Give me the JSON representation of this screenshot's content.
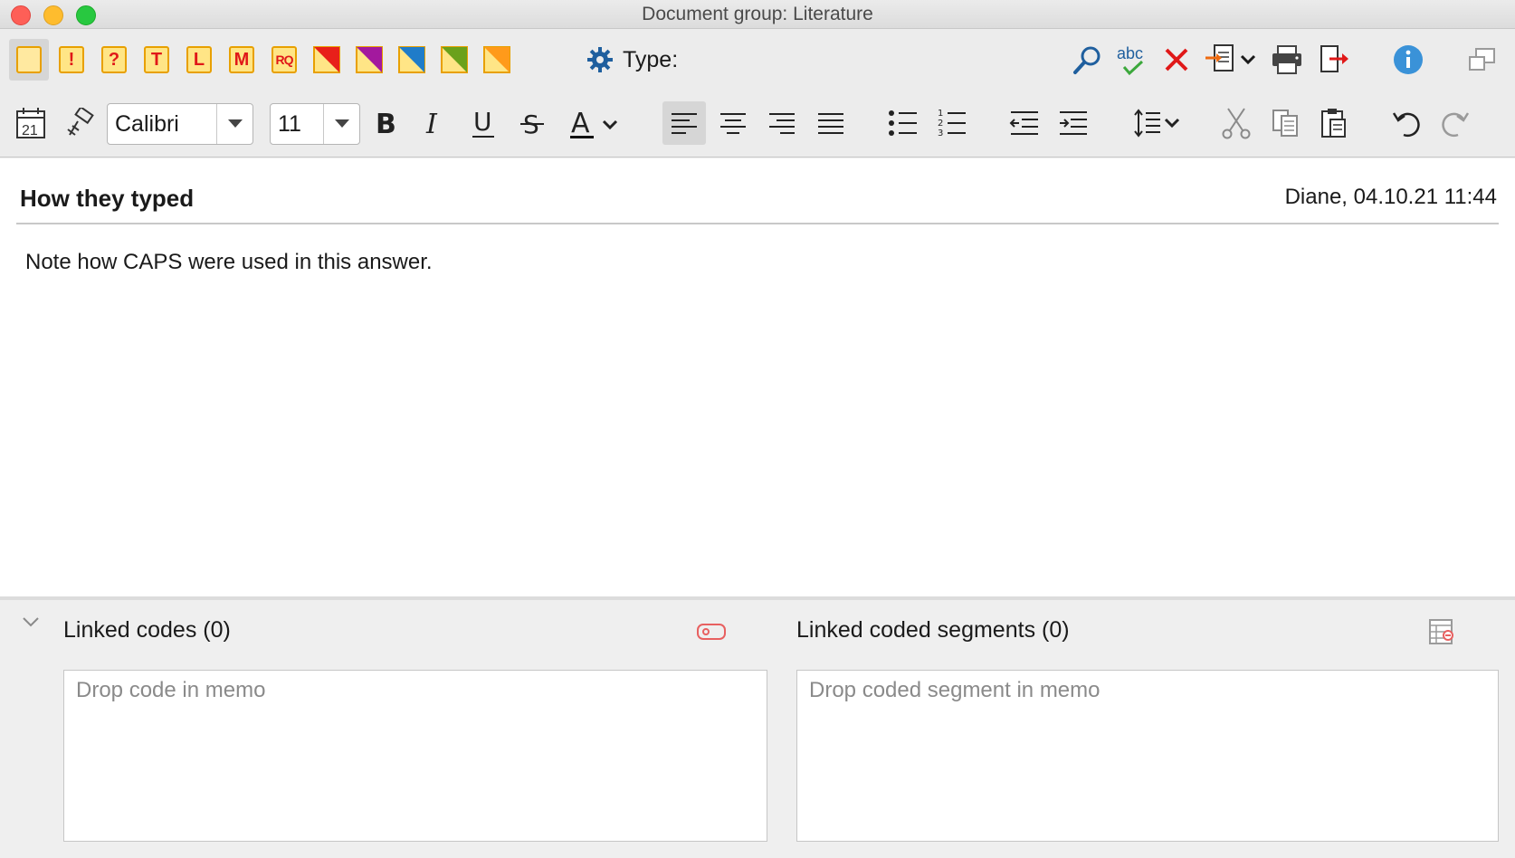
{
  "window": {
    "title": "Document group: Literature"
  },
  "toolbar": {
    "memo_types": [
      {
        "name": "memo-type-standard",
        "letter": ""
      },
      {
        "name": "memo-type-important",
        "letter": "!"
      },
      {
        "name": "memo-type-question",
        "letter": "?"
      },
      {
        "name": "memo-type-theory",
        "letter": "T"
      },
      {
        "name": "memo-type-literature",
        "letter": "L"
      },
      {
        "name": "memo-type-method",
        "letter": "M"
      },
      {
        "name": "memo-type-research-question",
        "letter": "RQ"
      },
      {
        "name": "memo-type-red",
        "color": "#e8201a"
      },
      {
        "name": "memo-type-purple",
        "color": "#a3199e"
      },
      {
        "name": "memo-type-blue",
        "color": "#1f7cc9"
      },
      {
        "name": "memo-type-green",
        "color": "#6aa11b"
      },
      {
        "name": "memo-type-orange",
        "color": "#ff9a1a"
      }
    ],
    "type_label": "Type:"
  },
  "format": {
    "font_family": "Calibri",
    "font_size": "11"
  },
  "memo": {
    "title": "How they typed",
    "meta": "Diane, 04.10.21 11:44",
    "body": "Note how CAPS were used in this answer."
  },
  "linked": {
    "codes_title": "Linked codes (0)",
    "codes_placeholder": "Drop code in memo",
    "segments_title": "Linked coded segments (0)",
    "segments_placeholder": "Drop coded segment in memo"
  },
  "colors": {
    "accent_blue": "#1f7cc9",
    "memo_fill": "#ffe586",
    "memo_border": "#e8a000",
    "alert_red": "#e01818"
  }
}
